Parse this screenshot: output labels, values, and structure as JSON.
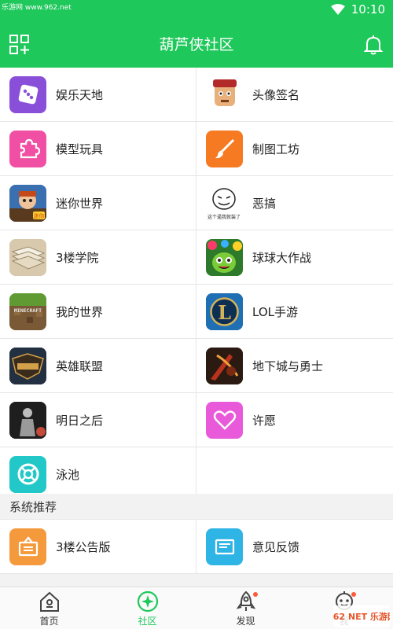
{
  "status_bar": {
    "watermark": "乐游网 www.962.net",
    "time": "10:10"
  },
  "header": {
    "title": "葫芦侠社区",
    "left_icon": "apps-add-icon",
    "right_icon": "bell-icon"
  },
  "categories": [
    {
      "label": "娱乐天地",
      "icon": "dice-icon",
      "color": "#8a4fd9"
    },
    {
      "label": "头像签名",
      "icon": "cartoon-avatar-icon",
      "color": "#ffffff"
    },
    {
      "label": "模型玩具",
      "icon": "puzzle-icon",
      "color": "#f04fa3"
    },
    {
      "label": "制图工坊",
      "icon": "brush-icon",
      "color": "#f57a22"
    },
    {
      "label": "迷你世界",
      "icon": "mini-world-game-icon",
      "color": "#3a6fb0"
    },
    {
      "label": "恶搞",
      "icon": "meme-face-icon",
      "color": "#ffffff"
    },
    {
      "label": "3楼学院",
      "icon": "book-icon",
      "color": "#cdbb9c"
    },
    {
      "label": "球球大作战",
      "icon": "ball-battle-icon",
      "color": "#5aa632"
    },
    {
      "label": "我的世界",
      "icon": "minecraft-icon",
      "color": "#6d8a3a"
    },
    {
      "label": "LOL手游",
      "icon": "lol-icon",
      "color": "#1a4f8a"
    },
    {
      "label": "英雄联盟",
      "icon": "league-of-legends-icon",
      "color": "#2a3340"
    },
    {
      "label": "地下城与勇士",
      "icon": "dnf-icon",
      "color": "#3b2418"
    },
    {
      "label": "明日之后",
      "icon": "lifeafter-icon",
      "color": "#2b2b2b"
    },
    {
      "label": "许愿",
      "icon": "heart-icon",
      "color": "#e85ad9"
    },
    {
      "label": "泳池",
      "icon": "lifebuoy-icon",
      "color": "#22c7c7"
    }
  ],
  "mini_world_badge": "迷你",
  "meme_caption": "这个逼我就装了",
  "minecraft_logo": "MINECRAFT",
  "lol_logo": "L",
  "system_section": {
    "title": "系统推荐",
    "items": [
      {
        "label": "3楼公告版",
        "icon": "notice-board-icon",
        "color": "#f59a3c"
      },
      {
        "label": "意见反馈",
        "icon": "feedback-mail-icon",
        "color": "#2fb4e6"
      }
    ]
  },
  "bottom_nav": [
    {
      "label": "首页",
      "icon": "home-icon",
      "active": false
    },
    {
      "label": "社区",
      "icon": "community-icon",
      "active": true
    },
    {
      "label": "发现",
      "icon": "rocket-icon",
      "active": false,
      "dot": true
    },
    {
      "label": "我",
      "icon": "avatar-robot-icon",
      "active": false,
      "dot": true
    }
  ],
  "corner_logo": "962 NET 乐游网",
  "colors": {
    "primary": "#1ec85a",
    "divider": "#e6e6e6",
    "badge": "#ff5a3c"
  }
}
